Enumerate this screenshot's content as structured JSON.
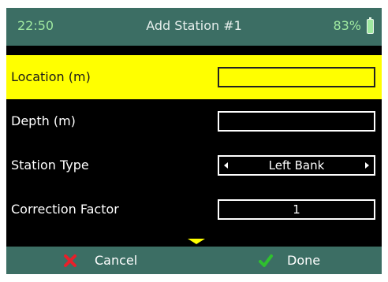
{
  "status_bar": {
    "time": "22:50",
    "title": "Add Station #1",
    "battery_percent": "83%",
    "battery_icon": "battery-icon"
  },
  "form": {
    "rows": [
      {
        "label": "Location (m)",
        "value": "",
        "selected": true
      },
      {
        "label": "Depth (m)",
        "value": ""
      },
      {
        "label": "Station Type",
        "value": "Left Bank"
      },
      {
        "label": "Correction Factor",
        "value": "1"
      }
    ]
  },
  "bottom_bar": {
    "cancel_label": "Cancel",
    "done_label": "Done",
    "cancel_icon": "x-icon",
    "done_icon": "check-icon"
  },
  "colors": {
    "bar_bg": "#3c6e64",
    "selected_row": "#ffff00",
    "cancel_red": "#e8202a",
    "done_green": "#2fc02f"
  }
}
